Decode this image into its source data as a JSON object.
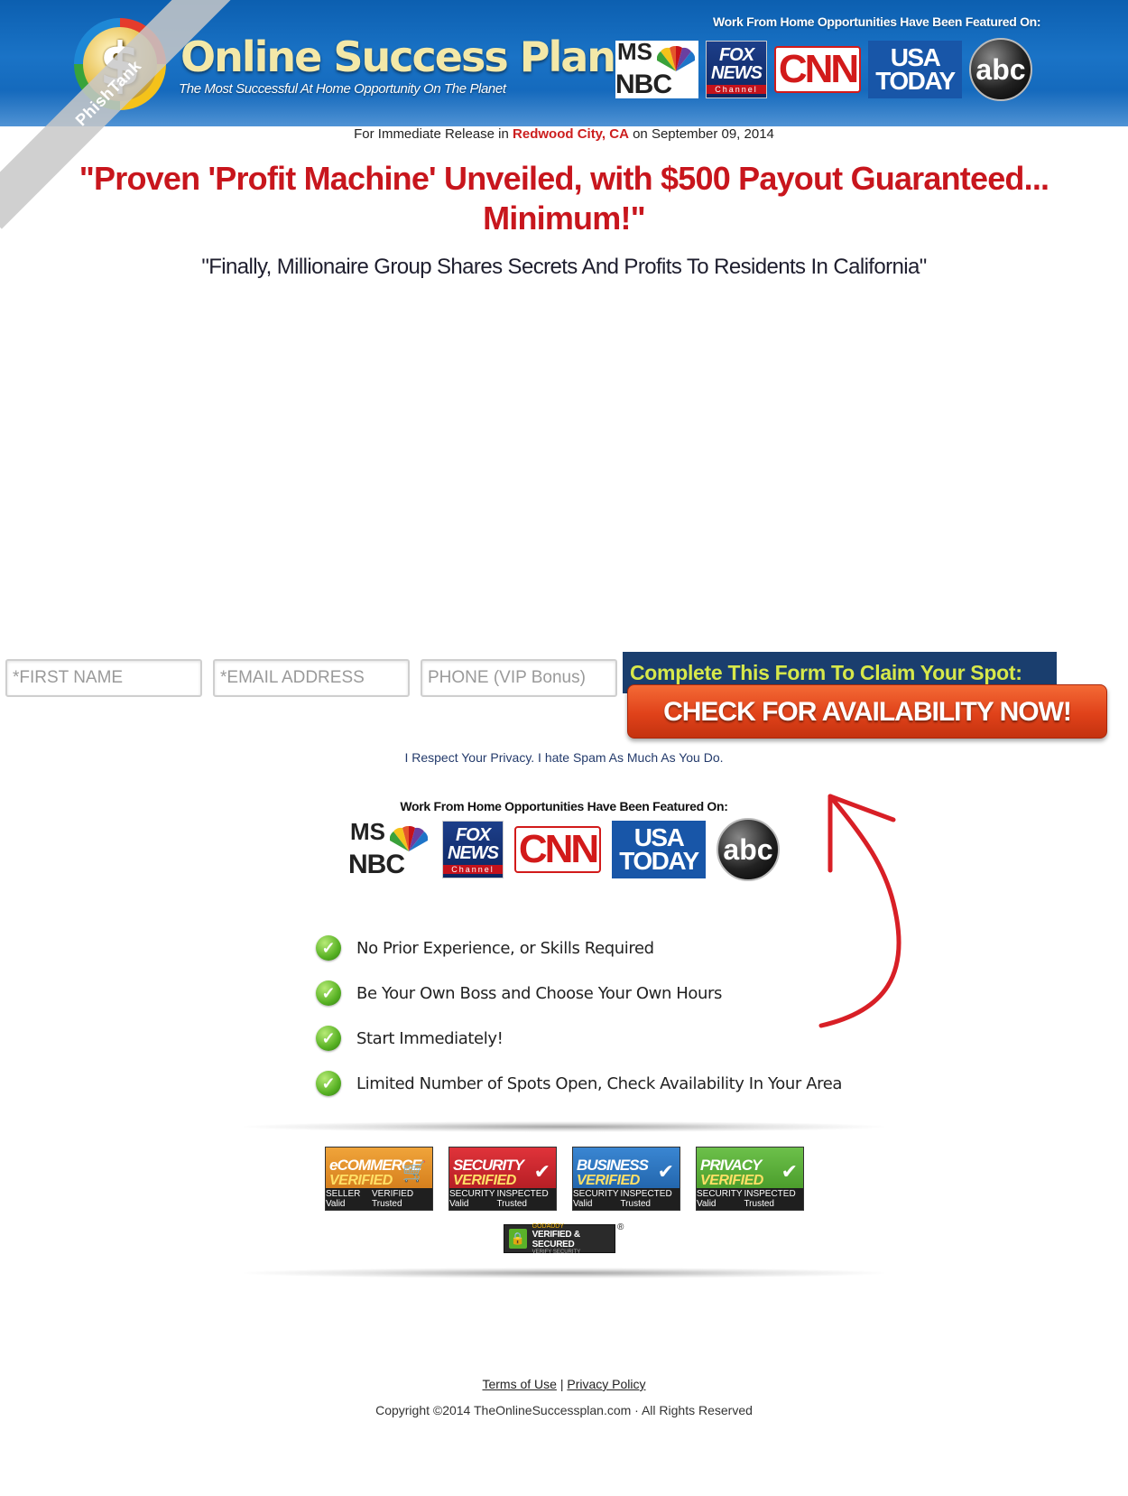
{
  "header": {
    "brand_title": "Online Success Plan",
    "brand_tagline": "The Most Successful At Home Opportunity On The Planet",
    "logo_symbol": "$",
    "featured_label": "Work From Home Opportunities Have Been Featured On:",
    "ribbon_text": "PhishTank"
  },
  "media_logos": {
    "msnbc_top": "MS",
    "msnbc_bottom": "NBC",
    "fox_line1": "FOX",
    "fox_line2": "NEWS",
    "fox_channel": "Channel",
    "cnn": "CNN",
    "usa_line1": "USA",
    "usa_line2": "TODAY",
    "abc": "abc"
  },
  "release": {
    "prefix": "For Immediate Release in",
    "location": "Redwood City, CA",
    "date_text": "on September 09, 2014"
  },
  "headline": "\"Proven 'Profit Machine' Unveiled, with $500 Payout Guaranteed... Minimum!\"",
  "subheadline": "\"Finally, Millionaire Group Shares Secrets And Profits To Residents In California\"",
  "form": {
    "first_name_placeholder": "*FIRST NAME",
    "email_placeholder": "*EMAIL ADDRESS",
    "phone_placeholder": "PHONE (VIP Bonus)",
    "banner_text": "Complete This Form To Claim Your Spot:",
    "cta_label": "CHECK FOR AVAILABILITY NOW!",
    "privacy_note": "I Respect Your Privacy. I hate Spam As Much As You Do."
  },
  "featured_mid": "Work From Home Opportunities Have Been Featured On:",
  "checklist": [
    "No Prior Experience, or Skills Required",
    "Be Your Own Boss and Choose Your Own Hours",
    "Start Immediately!",
    "Limited Number of Spots Open, Check Availability In Your Area"
  ],
  "badges": [
    {
      "title": "eCOMMERCE",
      "subtitle": "VERIFIED",
      "left": "SELLER Valid",
      "right": "VERIFIED Trusted",
      "color": "#d98a20"
    },
    {
      "title": "SECURITY",
      "subtitle": "VERIFIED",
      "left": "SECURITY Valid",
      "right": "INSPECTED Trusted",
      "color": "#c0202a"
    },
    {
      "title": "BUSINESS",
      "subtitle": "VERIFIED",
      "left": "SECURITY Valid",
      "right": "INSPECTED Trusted",
      "color": "#2a72c0"
    },
    {
      "title": "PRIVACY",
      "subtitle": "VERIFIED",
      "left": "SECURITY Valid",
      "right": "INSPECTED Trusted",
      "color": "#52a832"
    }
  ],
  "godaddy": {
    "brand": "GODADDY",
    "text": "VERIFIED & SECURED",
    "sub": "VERIFY SECURITY",
    "reg_mark": "®"
  },
  "footer": {
    "terms": "Terms of Use",
    "separator": "|",
    "privacy": "Privacy Policy",
    "copyright": "Copyright ©2014 TheOnlineSuccessplan.com · All Rights Reserved"
  },
  "colors": {
    "header_blue": "#1a73c6",
    "headline_red": "#c8161d",
    "cta_orange": "#e0421a",
    "banner_navy": "#1a3e6e",
    "banner_text": "#d7e84a",
    "check_green": "#58b224"
  }
}
